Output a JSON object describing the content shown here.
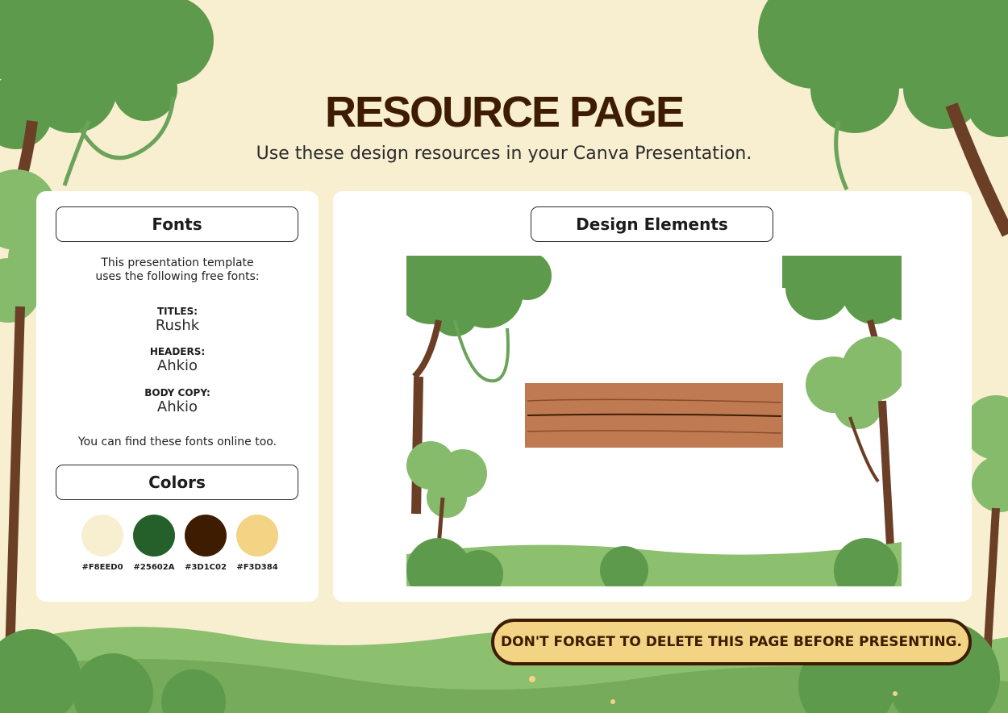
{
  "title": "RESOURCE PAGE",
  "subtitle": "Use these design resources in your Canva Presentation.",
  "fonts_panel": {
    "heading": "Fonts",
    "intro_line1": "This presentation template",
    "intro_line2": "uses the following free fonts:",
    "items": [
      {
        "label": "TITLES:",
        "font": "Rushk"
      },
      {
        "label": "HEADERS:",
        "font": "Ahkio"
      },
      {
        "label": "BODY COPY:",
        "font": "Ahkio"
      }
    ],
    "note": "You can find these fonts online too."
  },
  "colors_panel": {
    "heading": "Colors",
    "swatches": [
      {
        "hex": "#F8EED0",
        "color": "#F8EED0"
      },
      {
        "hex": "#25602A",
        "color": "#25602A"
      },
      {
        "hex": "#3D1C02",
        "color": "#3D1C02"
      },
      {
        "hex": "#F3D384",
        "color": "#F3D384"
      }
    ]
  },
  "design_panel": {
    "heading": "Design Elements"
  },
  "warning": "DON'T FORGET TO DELETE THIS PAGE BEFORE PRESENTING.",
  "palette": {
    "background": "#F8EED0",
    "foliage": "#6BA35A",
    "foliage_dark": "#3F7D3A",
    "trunk": "#6B3E26",
    "wood": "#C07A52"
  }
}
